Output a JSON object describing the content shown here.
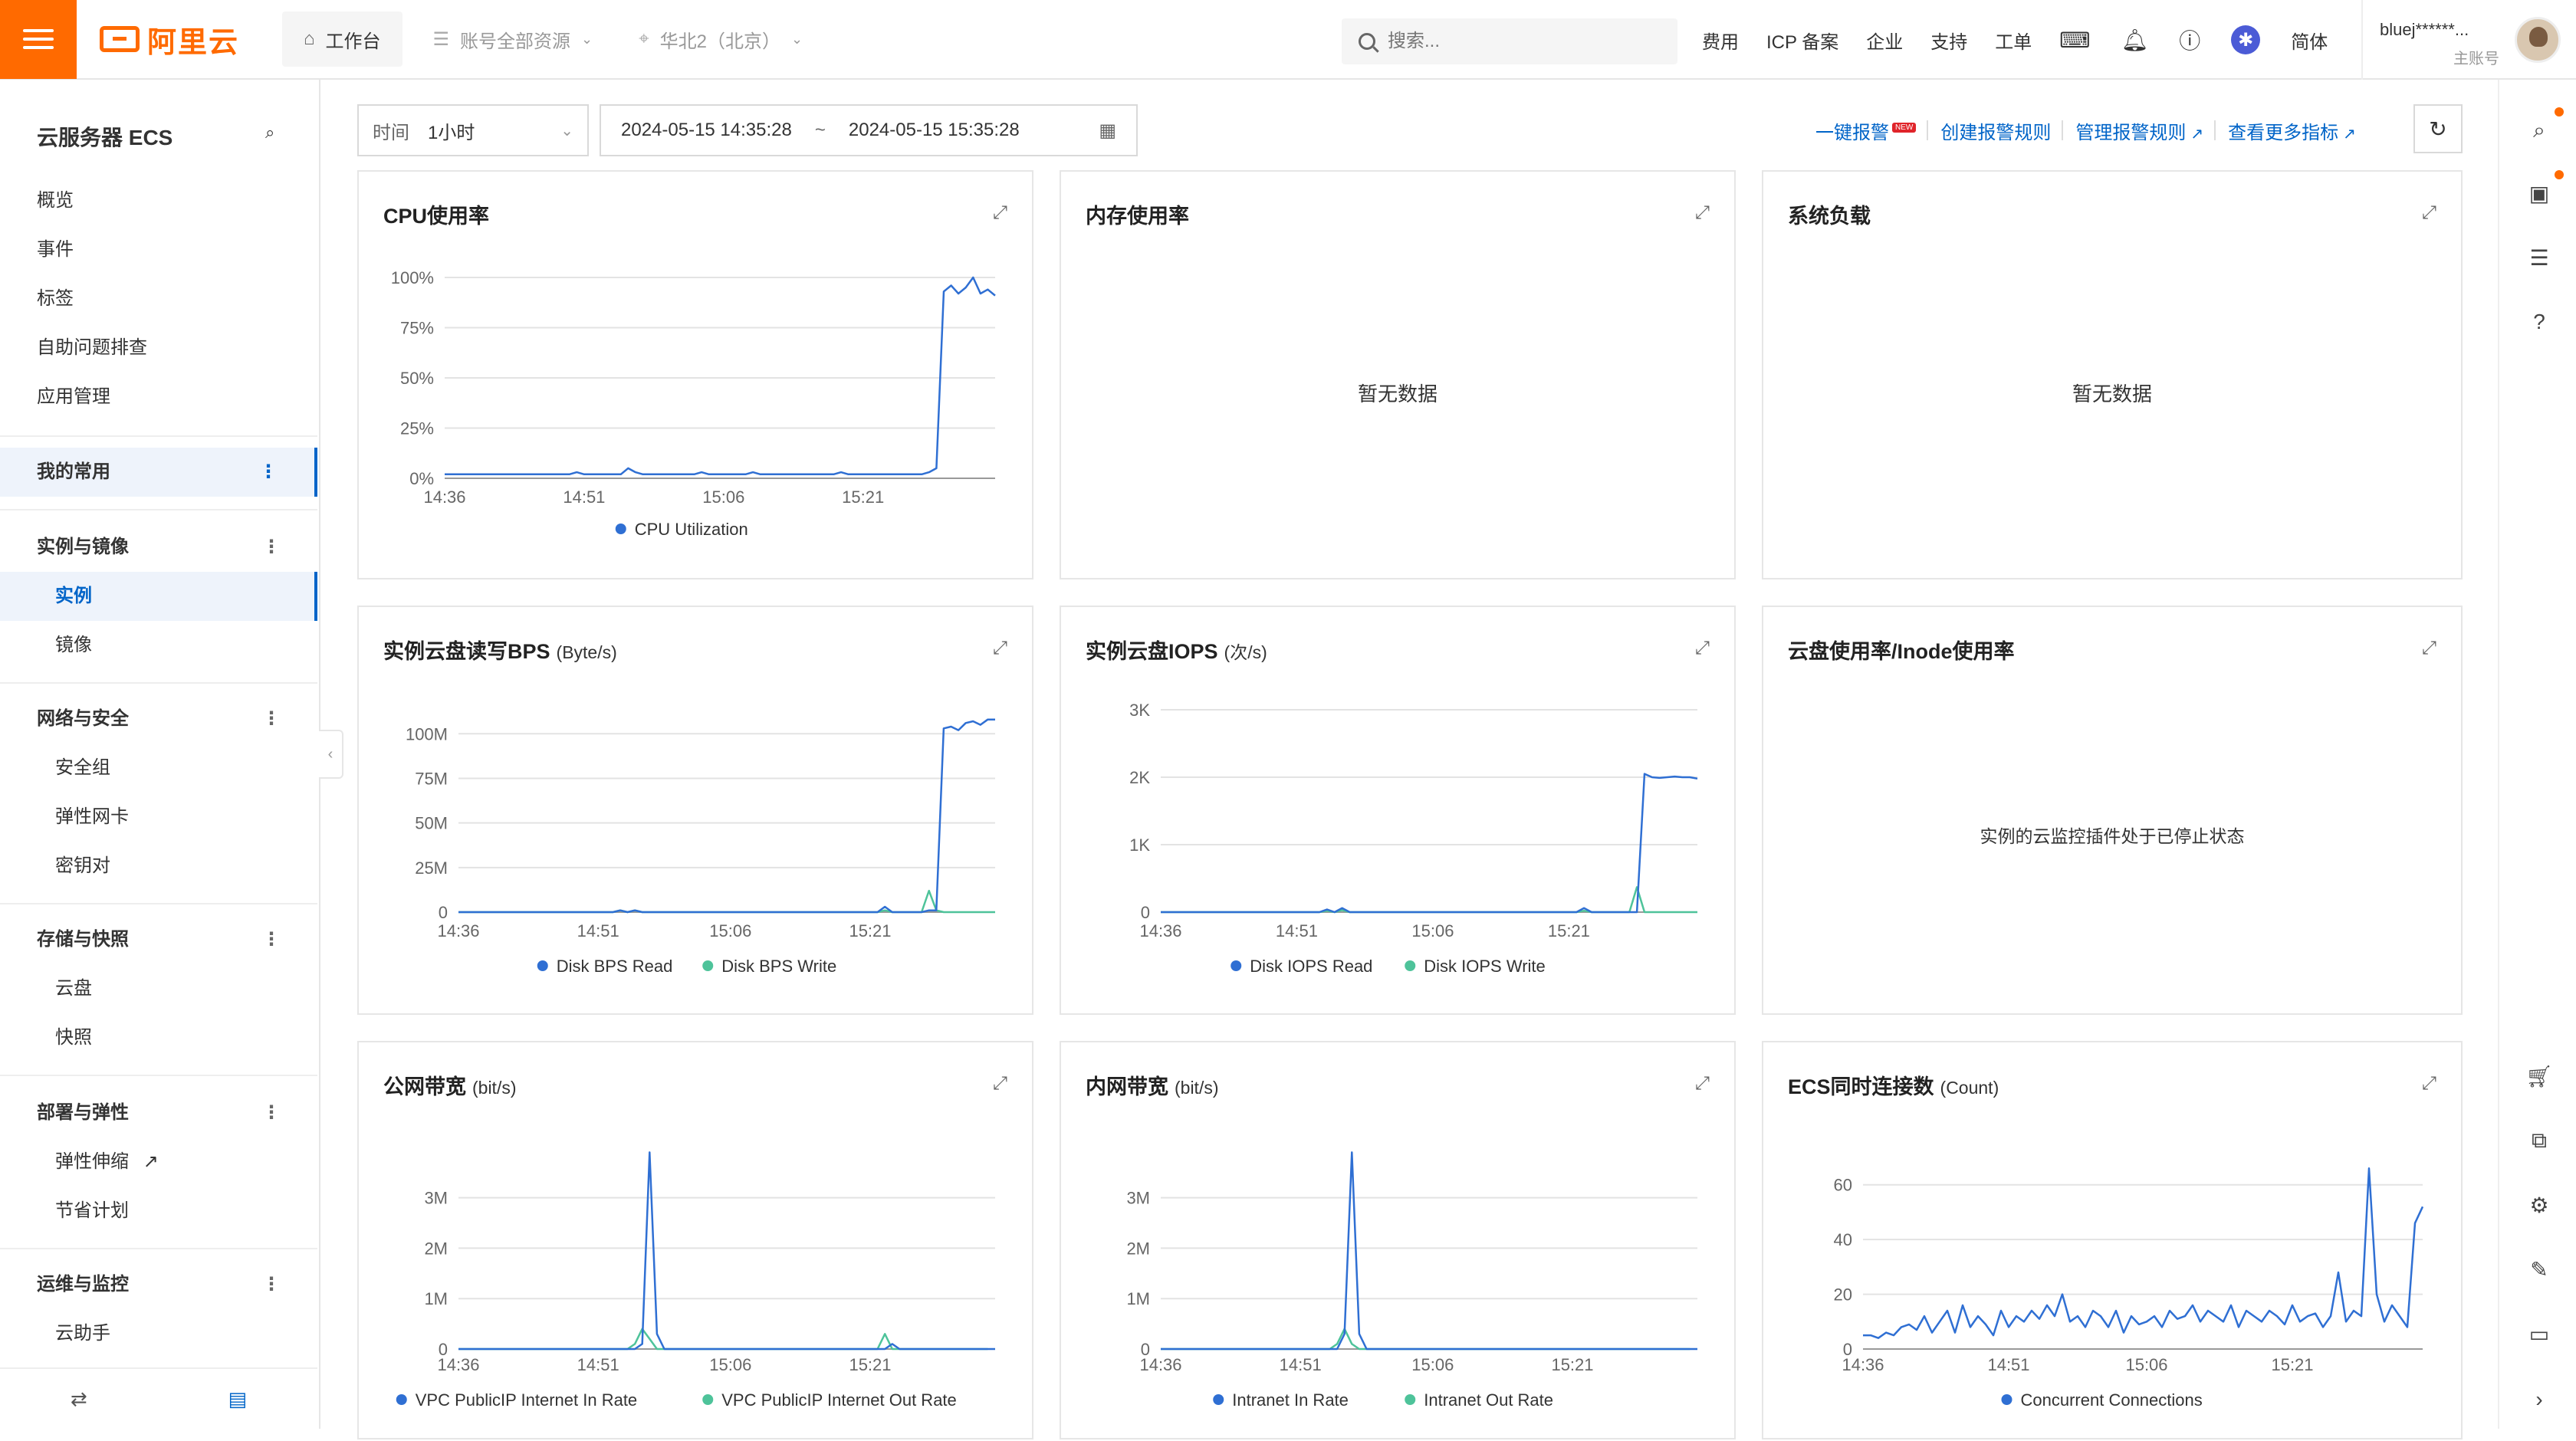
{
  "topbar": {
    "logo_text": "阿里云",
    "workbench": "工作台",
    "resources": "账号全部资源",
    "region": "华北2（北京）",
    "search_placeholder": "搜索...",
    "links": [
      "费用",
      "ICP 备案",
      "企业",
      "支持",
      "工单"
    ],
    "lang": "简体",
    "account_name": "bluej******...",
    "account_type": "主账号"
  },
  "sidebar": {
    "title": "云服务器 ECS",
    "top_items": [
      "概览",
      "事件",
      "标签",
      "自助问题排查",
      "应用管理"
    ],
    "groups": {
      "favorites": "我的常用",
      "instances": {
        "label": "实例与镜像",
        "items": [
          "实例",
          "镜像"
        ]
      },
      "network": {
        "label": "网络与安全",
        "items": [
          "安全组",
          "弹性网卡",
          "密钥对"
        ]
      },
      "storage": {
        "label": "存储与快照",
        "items": [
          "云盘",
          "快照"
        ]
      },
      "deploy": {
        "label": "部署与弹性",
        "items": [
          "弹性伸缩",
          "节省计划"
        ]
      },
      "ops": {
        "label": "运维与监控",
        "items": [
          "云助手"
        ]
      }
    }
  },
  "toolbar": {
    "time_label": "时间",
    "time_value": "1小时",
    "start": "2024-05-15 14:35:28",
    "tilde": "~",
    "end": "2024-05-15 15:35:28",
    "links": {
      "alarm": "一键报警",
      "new_badge": "NEW",
      "create_rule": "创建报警规则",
      "manage_rule": "管理报警规则",
      "more_metrics": "查看更多指标"
    }
  },
  "cards": {
    "cpu": {
      "title": "CPU使用率"
    },
    "mem": {
      "title": "内存使用率",
      "empty": "暂无数据"
    },
    "load": {
      "title": "系统负载",
      "empty": "暂无数据"
    },
    "disk_bps": {
      "title": "实例云盘读写BPS",
      "unit": "(Byte/s)"
    },
    "disk_iops": {
      "title": "实例云盘IOPS",
      "unit": "(次/s)"
    },
    "disk_usage": {
      "title": "云盘使用率/Inode使用率",
      "empty": "实例的云监控插件处于已停止状态"
    },
    "public_bw": {
      "title": "公网带宽",
      "unit": "(bit/s)"
    },
    "private_bw": {
      "title": "内网带宽",
      "unit": "(bit/s)"
    },
    "conn": {
      "title": "ECS同时连接数",
      "unit": "(Count)"
    }
  },
  "colors": {
    "accent": "#ff6a00",
    "link": "#0064c8",
    "series1": "#2f6fd3",
    "series2": "#4ec39a"
  },
  "chart_data": [
    {
      "id": "cpu",
      "type": "line",
      "x": [
        "14:36",
        "14:51",
        "15:06",
        "15:21"
      ],
      "yticks": [
        "0%",
        "25%",
        "50%",
        "75%",
        "100%"
      ],
      "ylim": [
        0,
        100
      ],
      "series": [
        {
          "name": "CPU Utilization",
          "color": "#2f6fd3",
          "values": [
            2,
            2,
            2,
            2,
            2,
            2,
            2,
            2,
            2,
            2,
            2,
            2,
            2,
            2,
            2,
            2,
            2,
            2,
            3,
            2,
            2,
            2,
            2,
            2,
            2,
            5,
            3,
            2,
            2,
            2,
            2,
            2,
            2,
            2,
            2,
            3,
            2,
            2,
            2,
            2,
            2,
            2,
            3,
            2,
            2,
            2,
            2,
            2,
            2,
            2,
            2,
            2,
            2,
            2,
            3,
            2,
            2,
            2,
            2,
            2,
            2,
            2,
            2,
            2,
            2,
            2,
            3,
            5,
            93,
            96,
            92,
            95,
            100,
            92,
            94,
            91
          ]
        }
      ]
    },
    {
      "id": "disk_bps",
      "type": "line",
      "x": [
        "14:36",
        "14:51",
        "15:06",
        "15:21"
      ],
      "yticks": [
        "0",
        "25M",
        "50M",
        "75M",
        "100M"
      ],
      "ylim": [
        0,
        110
      ],
      "series": [
        {
          "name": "Disk BPS Read",
          "color": "#2f6fd3",
          "values": [
            0,
            0,
            0,
            0,
            0,
            0,
            0,
            0,
            0,
            0,
            0,
            0,
            0,
            0,
            0,
            0,
            0,
            0,
            0,
            0,
            0,
            0,
            1,
            0,
            1,
            0,
            0,
            0,
            0,
            0,
            0,
            0,
            0,
            0,
            0,
            0,
            0,
            0,
            0,
            0,
            0,
            0,
            0,
            0,
            0,
            0,
            0,
            0,
            0,
            0,
            0,
            0,
            0,
            0,
            0,
            0,
            0,
            0,
            3,
            0,
            0,
            0,
            0,
            0,
            1,
            1,
            103,
            104,
            102,
            106,
            107,
            105,
            108,
            108
          ]
        },
        {
          "name": "Disk BPS Write",
          "color": "#4ec39a",
          "values": [
            0,
            0,
            0,
            0,
            0,
            0,
            0,
            0,
            0,
            0,
            0,
            0,
            0,
            0,
            0,
            0,
            0,
            0,
            0,
            0,
            0,
            0,
            1,
            0,
            1,
            0,
            0,
            0,
            0,
            0,
            0,
            0,
            0,
            0,
            0,
            0,
            0,
            0,
            0,
            0,
            0,
            0,
            0,
            0,
            0,
            0,
            0,
            0,
            0,
            0,
            0,
            0,
            0,
            0,
            0,
            0,
            0,
            0,
            1,
            0,
            0,
            0,
            0,
            0,
            12,
            1,
            0,
            0,
            0,
            0,
            0,
            0,
            0,
            0
          ]
        }
      ]
    },
    {
      "id": "disk_iops",
      "type": "line",
      "x": [
        "14:36",
        "14:51",
        "15:06",
        "15:21"
      ],
      "yticks": [
        "0",
        "1K",
        "2K",
        "3K"
      ],
      "ylim": [
        0,
        3000
      ],
      "series": [
        {
          "name": "Disk IOPS Read",
          "color": "#2f6fd3",
          "values": [
            0,
            0,
            0,
            0,
            0,
            0,
            0,
            0,
            0,
            0,
            0,
            0,
            0,
            0,
            0,
            0,
            0,
            0,
            0,
            0,
            0,
            0,
            40,
            0,
            60,
            0,
            0,
            0,
            0,
            0,
            0,
            0,
            0,
            0,
            0,
            0,
            0,
            0,
            0,
            0,
            0,
            0,
            0,
            0,
            0,
            0,
            0,
            0,
            0,
            0,
            0,
            0,
            0,
            0,
            0,
            0,
            60,
            0,
            0,
            0,
            0,
            0,
            0,
            0,
            2050,
            2000,
            1990,
            2000,
            2010,
            2000,
            2000,
            1980
          ]
        },
        {
          "name": "Disk IOPS Write",
          "color": "#4ec39a",
          "values": [
            0,
            0,
            0,
            0,
            0,
            0,
            0,
            0,
            0,
            0,
            0,
            0,
            0,
            0,
            0,
            0,
            0,
            0,
            0,
            0,
            0,
            0,
            20,
            0,
            30,
            0,
            0,
            0,
            0,
            0,
            0,
            0,
            0,
            0,
            0,
            0,
            0,
            0,
            0,
            0,
            0,
            0,
            0,
            0,
            0,
            0,
            0,
            0,
            0,
            0,
            0,
            0,
            0,
            0,
            0,
            0,
            20,
            0,
            0,
            0,
            0,
            0,
            0,
            370,
            0,
            0,
            0,
            0,
            0,
            0,
            0,
            0
          ]
        }
      ]
    },
    {
      "id": "public_bw",
      "type": "line",
      "x": [
        "14:36",
        "14:51",
        "15:06",
        "15:21"
      ],
      "yticks": [
        "0",
        "1M",
        "2M",
        "3M"
      ],
      "ylim": [
        0,
        3800000
      ],
      "series": [
        {
          "name": "VPC PublicIP Internet In Rate",
          "color": "#2f6fd3",
          "values": [
            0,
            0,
            0,
            0,
            0,
            0,
            0,
            0,
            0,
            0,
            0,
            0,
            0,
            0,
            0,
            0,
            0,
            0,
            0,
            0,
            0,
            0,
            0,
            0,
            0,
            100000,
            3900000,
            300000,
            0,
            0,
            0,
            0,
            0,
            0,
            0,
            0,
            0,
            0,
            0,
            0,
            0,
            0,
            0,
            0,
            0,
            0,
            0,
            0,
            0,
            0,
            0,
            0,
            0,
            0,
            0,
            0,
            0,
            0,
            0,
            100000,
            0,
            0,
            0,
            0,
            0,
            0,
            0,
            0,
            0,
            0,
            0,
            0,
            0,
            0
          ]
        },
        {
          "name": "VPC PublicIP Internet Out Rate",
          "color": "#4ec39a",
          "values": [
            0,
            0,
            0,
            0,
            0,
            0,
            0,
            0,
            0,
            0,
            0,
            0,
            0,
            0,
            0,
            0,
            0,
            0,
            0,
            0,
            0,
            0,
            0,
            0,
            100000,
            400000,
            200000,
            0,
            0,
            0,
            0,
            0,
            0,
            0,
            0,
            0,
            0,
            0,
            0,
            0,
            0,
            0,
            0,
            0,
            0,
            0,
            0,
            0,
            0,
            0,
            0,
            0,
            0,
            0,
            0,
            0,
            0,
            0,
            300000,
            0,
            0,
            0,
            0,
            0,
            0,
            0,
            0,
            0,
            0,
            0,
            0,
            0,
            0
          ]
        }
      ]
    },
    {
      "id": "private_bw",
      "type": "line",
      "x": [
        "14:36",
        "14:51",
        "15:06",
        "15:21"
      ],
      "yticks": [
        "0",
        "1M",
        "2M",
        "3M"
      ],
      "ylim": [
        0,
        3800000
      ],
      "series": [
        {
          "name": "Intranet In Rate",
          "color": "#2f6fd3",
          "values": [
            0,
            0,
            0,
            0,
            0,
            0,
            0,
            0,
            0,
            0,
            0,
            0,
            0,
            0,
            0,
            0,
            0,
            0,
            0,
            0,
            0,
            0,
            0,
            0,
            0,
            300000,
            3900000,
            300000,
            0,
            0,
            0,
            0,
            0,
            0,
            0,
            0,
            0,
            0,
            0,
            0,
            0,
            0,
            0,
            0,
            0,
            0,
            0,
            0,
            0,
            0,
            0,
            0,
            0,
            0,
            0,
            0,
            0,
            0,
            0,
            0,
            0,
            0,
            0,
            0,
            0,
            0,
            0,
            0,
            0,
            0,
            0,
            0,
            0,
            0
          ]
        },
        {
          "name": "Intranet Out Rate",
          "color": "#4ec39a",
          "values": [
            0,
            0,
            0,
            0,
            0,
            0,
            0,
            0,
            0,
            0,
            0,
            0,
            0,
            0,
            0,
            0,
            0,
            0,
            0,
            0,
            0,
            0,
            0,
            0,
            100000,
            400000,
            100000,
            0,
            0,
            0,
            0,
            0,
            0,
            0,
            0,
            0,
            0,
            0,
            0,
            0,
            0,
            0,
            0,
            0,
            0,
            0,
            0,
            0,
            0,
            0,
            0,
            0,
            0,
            0,
            0,
            0,
            0,
            0,
            0,
            0,
            0,
            0,
            0,
            0,
            0,
            0,
            0,
            0,
            0,
            0,
            0,
            0,
            0
          ]
        }
      ]
    },
    {
      "id": "conn",
      "type": "line",
      "x": [
        "14:36",
        "14:51",
        "15:06",
        "15:21"
      ],
      "yticks": [
        "0",
        "20",
        "40",
        "60"
      ],
      "ylim": [
        0,
        70
      ],
      "series": [
        {
          "name": "Concurrent Connections",
          "color": "#2f6fd3",
          "values": [
            5,
            5,
            4,
            6,
            5,
            8,
            9,
            7,
            12,
            6,
            10,
            14,
            6,
            16,
            8,
            12,
            9,
            5,
            14,
            8,
            12,
            10,
            14,
            11,
            16,
            12,
            20,
            10,
            12,
            8,
            14,
            12,
            8,
            14,
            6,
            12,
            9,
            10,
            12,
            8,
            14,
            11,
            12,
            16,
            10,
            14,
            12,
            10,
            16,
            8,
            14,
            12,
            10,
            14,
            12,
            9,
            16,
            10,
            12,
            13,
            8,
            12,
            28,
            10,
            14,
            12,
            66,
            20,
            10,
            16,
            12,
            8,
            46,
            52
          ]
        }
      ]
    }
  ]
}
